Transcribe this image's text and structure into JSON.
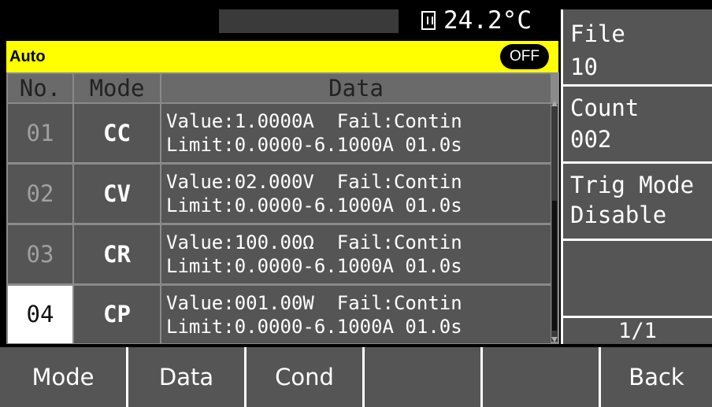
{
  "status": {
    "temperature": "24.2°C",
    "usb_icon": "usb-drive-icon"
  },
  "header": {
    "mode": "Auto",
    "output_state": "OFF"
  },
  "table": {
    "columns": [
      "No.",
      "Mode",
      "Data"
    ],
    "rows": [
      {
        "no": "01",
        "mode": "CC",
        "line1": "Value:1.0000A  Fail:Contin",
        "line2": "Limit:0.0000-6.1000A 01.0s"
      },
      {
        "no": "02",
        "mode": "CV",
        "line1": "Value:02.000V  Fail:Contin",
        "line2": "Limit:0.0000-6.1000A 01.0s"
      },
      {
        "no": "03",
        "mode": "CR",
        "line1": "Value:100.00Ω  Fail:Contin",
        "line2": "Limit:0.0000-6.1000A 01.0s"
      },
      {
        "no": "04",
        "mode": "CP",
        "line1": "Value:001.00W  Fail:Contin",
        "line2": "Limit:0.0000-6.1000A 01.0s"
      }
    ]
  },
  "right_panel": {
    "file_label": "File",
    "file_value": "10",
    "count_label": "Count",
    "count_value": "002",
    "trig_label": "Trig Mode",
    "trig_value": "Disable",
    "page": "1/1"
  },
  "softkeys": [
    "Mode",
    "Data",
    "Cond",
    "",
    "",
    "Back"
  ]
}
